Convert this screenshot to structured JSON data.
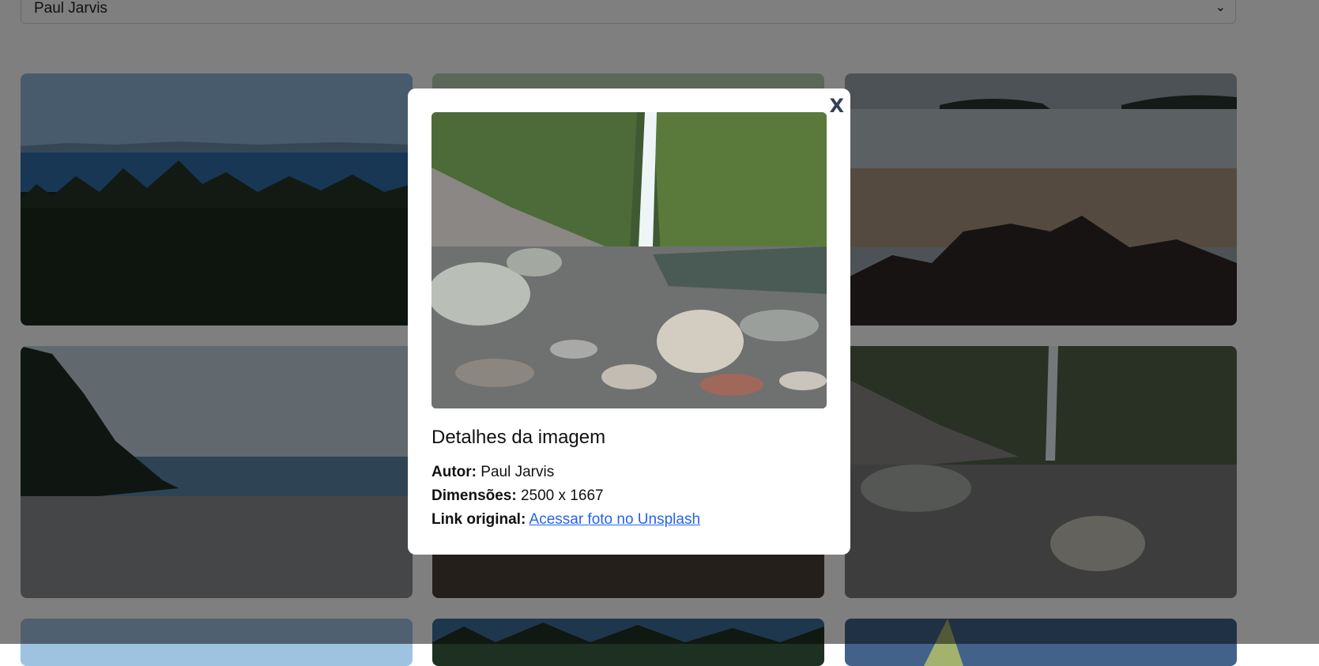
{
  "filter": {
    "selected_author": "Paul Jarvis"
  },
  "modal": {
    "close_label": "X",
    "title": "Detalhes da imagem",
    "author_label": "Autor:",
    "author_value": "Paul Jarvis",
    "dimensions_label": "Dimensões:",
    "dimensions_value": "2500 x 1667",
    "link_label": "Link original:",
    "link_text": "Acessar foto no Unsplash"
  },
  "icons": {
    "select_chevron": "chevron-down-icon"
  }
}
